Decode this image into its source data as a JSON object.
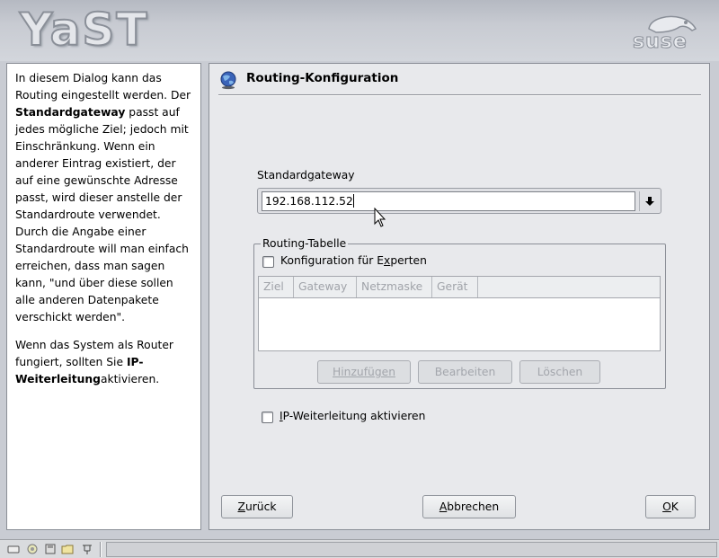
{
  "header": {
    "yast_logo": "YaST",
    "suse_logo": "suse"
  },
  "help": {
    "p1_a": "In diesem Dialog kann das Routing eingestellt werden. Der ",
    "p1_b": "Standardgateway",
    "p1_c": " passt auf jedes mögliche Ziel; jedoch mit Einschränkung. Wenn ein anderer Eintrag existiert, der auf eine gewünschte Adresse passt, wird dieser anstelle der Standardroute verwendet. Durch die Angabe einer Standardroute will man einfach erreichen, dass man sagen kann, \"und über diese sollen alle anderen Datenpakete verschickt werden\".",
    "p2_a": "Wenn das System als Router fungiert, sollten Sie ",
    "p2_b": "IP-Weiterleitung",
    "p2_c": "aktivieren."
  },
  "dialog": {
    "title": "Routing-Konfiguration",
    "gateway_label_pre": "Standard",
    "gateway_label_key": "g",
    "gateway_label_post": "ateway",
    "gateway_value": "192.168.112.52",
    "group_title": "Routing-Tabelle",
    "expert_label_pre": "Konfiguration für E",
    "expert_label_key": "x",
    "expert_label_post": "perten",
    "columns": [
      "Ziel",
      "Gateway",
      "Netzmaske",
      "Gerät"
    ],
    "add_button": "Hinzufügen",
    "edit_button": "Bearbeiten",
    "delete_button": "Löschen",
    "forward_label_key": "I",
    "forward_label_post": "P-Weiterleitung aktivieren"
  },
  "buttons": {
    "back_key": "Z",
    "back_rest": "urück",
    "cancel_key": "A",
    "cancel_rest": "bbrechen",
    "ok_key": "O",
    "ok_rest": "K"
  },
  "icons": {
    "title": "globe-icon",
    "dropdown": "arrow-down-icon",
    "taskbar": [
      "keyboard-icon",
      "gear-icon",
      "disk-icon",
      "folder-icon",
      "network-icon"
    ]
  }
}
